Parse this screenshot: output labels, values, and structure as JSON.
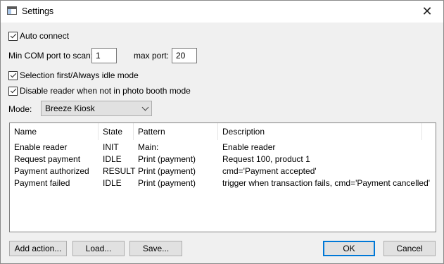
{
  "window": {
    "title": "Settings",
    "app_icon": "window-icon",
    "close_glyph": "✕"
  },
  "auto_connect": {
    "label": "Auto connect",
    "checked": true
  },
  "com": {
    "min_label": "Min COM port to scan:",
    "min_value": "1",
    "max_label": "max port:",
    "max_value": "20"
  },
  "selection_first": {
    "label": "Selection first/Always idle mode",
    "checked": true
  },
  "disable_reader": {
    "label": "Disable reader when not in photo booth mode",
    "checked": true
  },
  "mode": {
    "label": "Mode:",
    "selected": "Breeze Kiosk"
  },
  "table": {
    "columns": [
      "Name",
      "State",
      "Pattern",
      "Description"
    ],
    "rows": [
      {
        "name": "Enable reader",
        "state": "INIT",
        "pattern": "Main:",
        "description": "Enable reader"
      },
      {
        "name": "Request payment",
        "state": "IDLE",
        "pattern": "Print (payment)",
        "description": "Request 100, product 1"
      },
      {
        "name": "Payment authorized",
        "state": "RESULT",
        "pattern": "Print (payment)",
        "description": "cmd='Payment accepted'"
      },
      {
        "name": "Payment failed",
        "state": "IDLE",
        "pattern": "Print (payment)",
        "description": "trigger when transaction fails, cmd='Payment cancelled'"
      }
    ]
  },
  "buttons": {
    "add_action": "Add action...",
    "load": "Load...",
    "save": "Save...",
    "ok": "OK",
    "cancel": "Cancel"
  }
}
